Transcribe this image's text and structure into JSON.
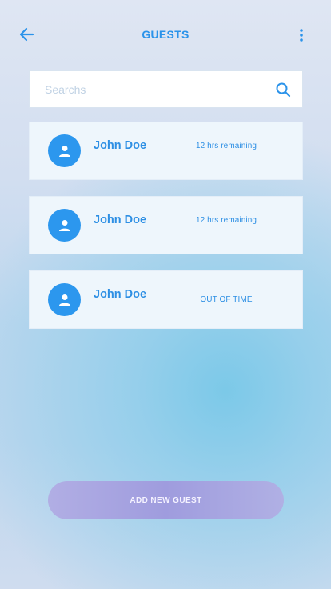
{
  "header": {
    "title": "GUESTS",
    "back_icon": "arrow-left-icon",
    "menu_icon": "more-vertical-icon"
  },
  "search": {
    "placeholder": "Searchs",
    "value": "",
    "icon": "search-icon"
  },
  "guests": [
    {
      "name": "John Doe",
      "status": "12 hrs remaining",
      "avatar_icon": "person-icon"
    },
    {
      "name": "John Doe",
      "status": "12 hrs remaining",
      "avatar_icon": "person-icon"
    },
    {
      "name": "John Doe",
      "status": "OUT OF TIME",
      "avatar_icon": "person-icon"
    }
  ],
  "actions": {
    "add_guest_label": "ADD NEW GUEST"
  },
  "colors": {
    "accent": "#2b93ea",
    "card_background": "#eef6fc",
    "button_gradient_start": "#b1aee4",
    "button_gradient_end": "#9f9cde"
  }
}
